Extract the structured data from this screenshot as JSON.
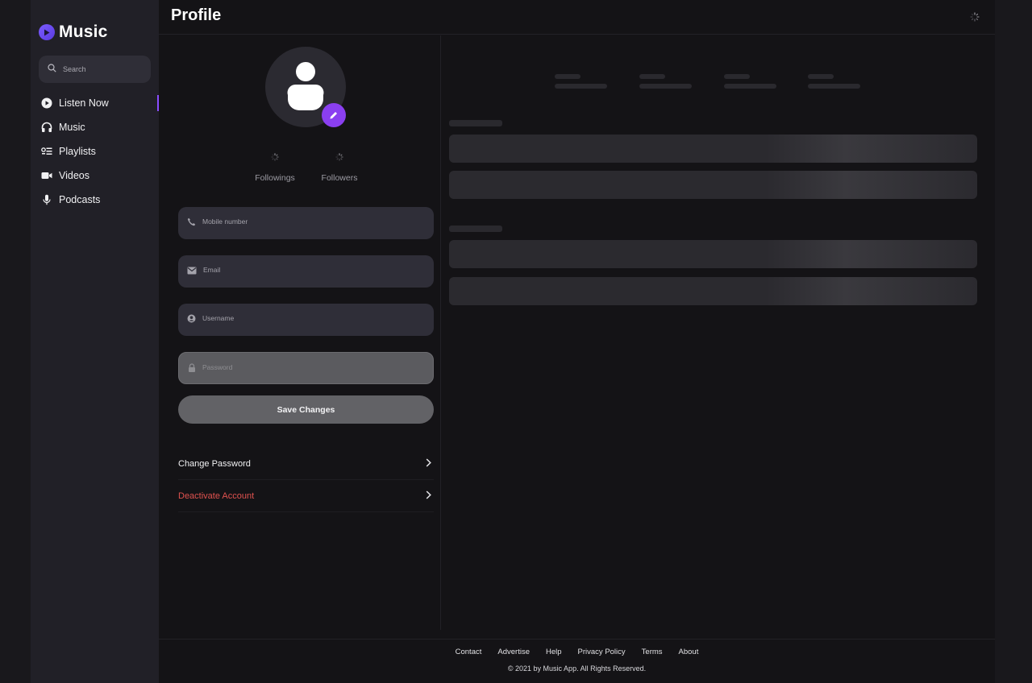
{
  "app": {
    "name": "Music"
  },
  "sidebar": {
    "search_placeholder": "Search",
    "items": [
      {
        "label": "Listen Now",
        "icon": "play-circle-icon",
        "active": true
      },
      {
        "label": "Music",
        "icon": "headphones-icon",
        "active": false
      },
      {
        "label": "Playlists",
        "icon": "playlist-icon",
        "active": false
      },
      {
        "label": "Videos",
        "icon": "video-icon",
        "active": false
      },
      {
        "label": "Podcasts",
        "icon": "microphone-icon",
        "active": false
      }
    ]
  },
  "header": {
    "title": "Profile"
  },
  "profile": {
    "stats": [
      {
        "label": "Followings"
      },
      {
        "label": "Followers"
      }
    ],
    "fields": {
      "mobile_placeholder": "Mobile number",
      "email_placeholder": "Email",
      "username_placeholder": "Username",
      "password_placeholder": "Password"
    },
    "save_label": "Save Changes",
    "change_password_label": "Change Password",
    "deactivate_label": "Deactivate Account"
  },
  "footer": {
    "links": [
      "Contact",
      "Advertise",
      "Help",
      "Privacy Policy",
      "Terms",
      "About"
    ],
    "copyright": "© 2021 by Music App. All Rights Reserved."
  },
  "colors": {
    "accent": "#8a3ff0",
    "danger": "#e0524f",
    "sidebar_bg": "#212027",
    "main_bg": "#141316"
  }
}
